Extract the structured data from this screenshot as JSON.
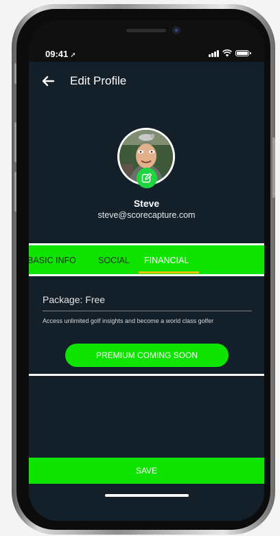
{
  "status_bar": {
    "time": "09:41",
    "location_icon": "location-arrow-icon",
    "signal_icon": "signal-bars-icon",
    "wifi_icon": "wifi-icon",
    "battery_icon": "battery-icon"
  },
  "header": {
    "back_icon": "arrow-left-icon",
    "title": "Edit Profile"
  },
  "profile": {
    "name": "Steve",
    "email": "steve@scorecapture.com",
    "edit_icon": "pencil-square-icon"
  },
  "tabs": [
    {
      "label": "BASIC INFO",
      "active": false
    },
    {
      "label": "SOCIAL",
      "active": false
    },
    {
      "label": "FINANCIAL",
      "active": true
    }
  ],
  "financial": {
    "package_label": "Package: Free",
    "description": "Access unlimited golf insights and become a world class golfer",
    "premium_button": "PREMIUM COMING SOON"
  },
  "footer": {
    "save_label": "SAVE"
  },
  "colors": {
    "background": "#13202a",
    "accent_green": "#0ee400",
    "tab_indicator": "#f3c000",
    "badge_green": "#1ed43f"
  }
}
